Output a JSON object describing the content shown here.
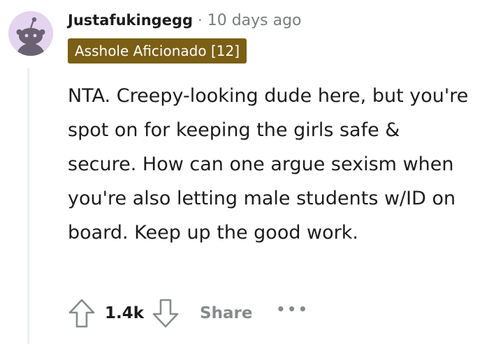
{
  "comment": {
    "username": "Justafukingegg",
    "separator": "·",
    "timestamp": "10 days ago",
    "flair": "Asshole Aficionado [12]",
    "flair_color": "#7a5f14",
    "avatar_icon": "reddit-snoo-avatar-icon",
    "body": "NTA. Creepy-looking dude here, but you're spot on for keeping the girls safe & secure. How can one argue sexism when you're also letting male students w/ID on board. Keep up the good work.",
    "actions": {
      "upvote_icon": "arrow-up-icon",
      "score": "1.4k",
      "downvote_icon": "arrow-down-icon",
      "share_label": "Share",
      "more_label": "•••"
    }
  }
}
